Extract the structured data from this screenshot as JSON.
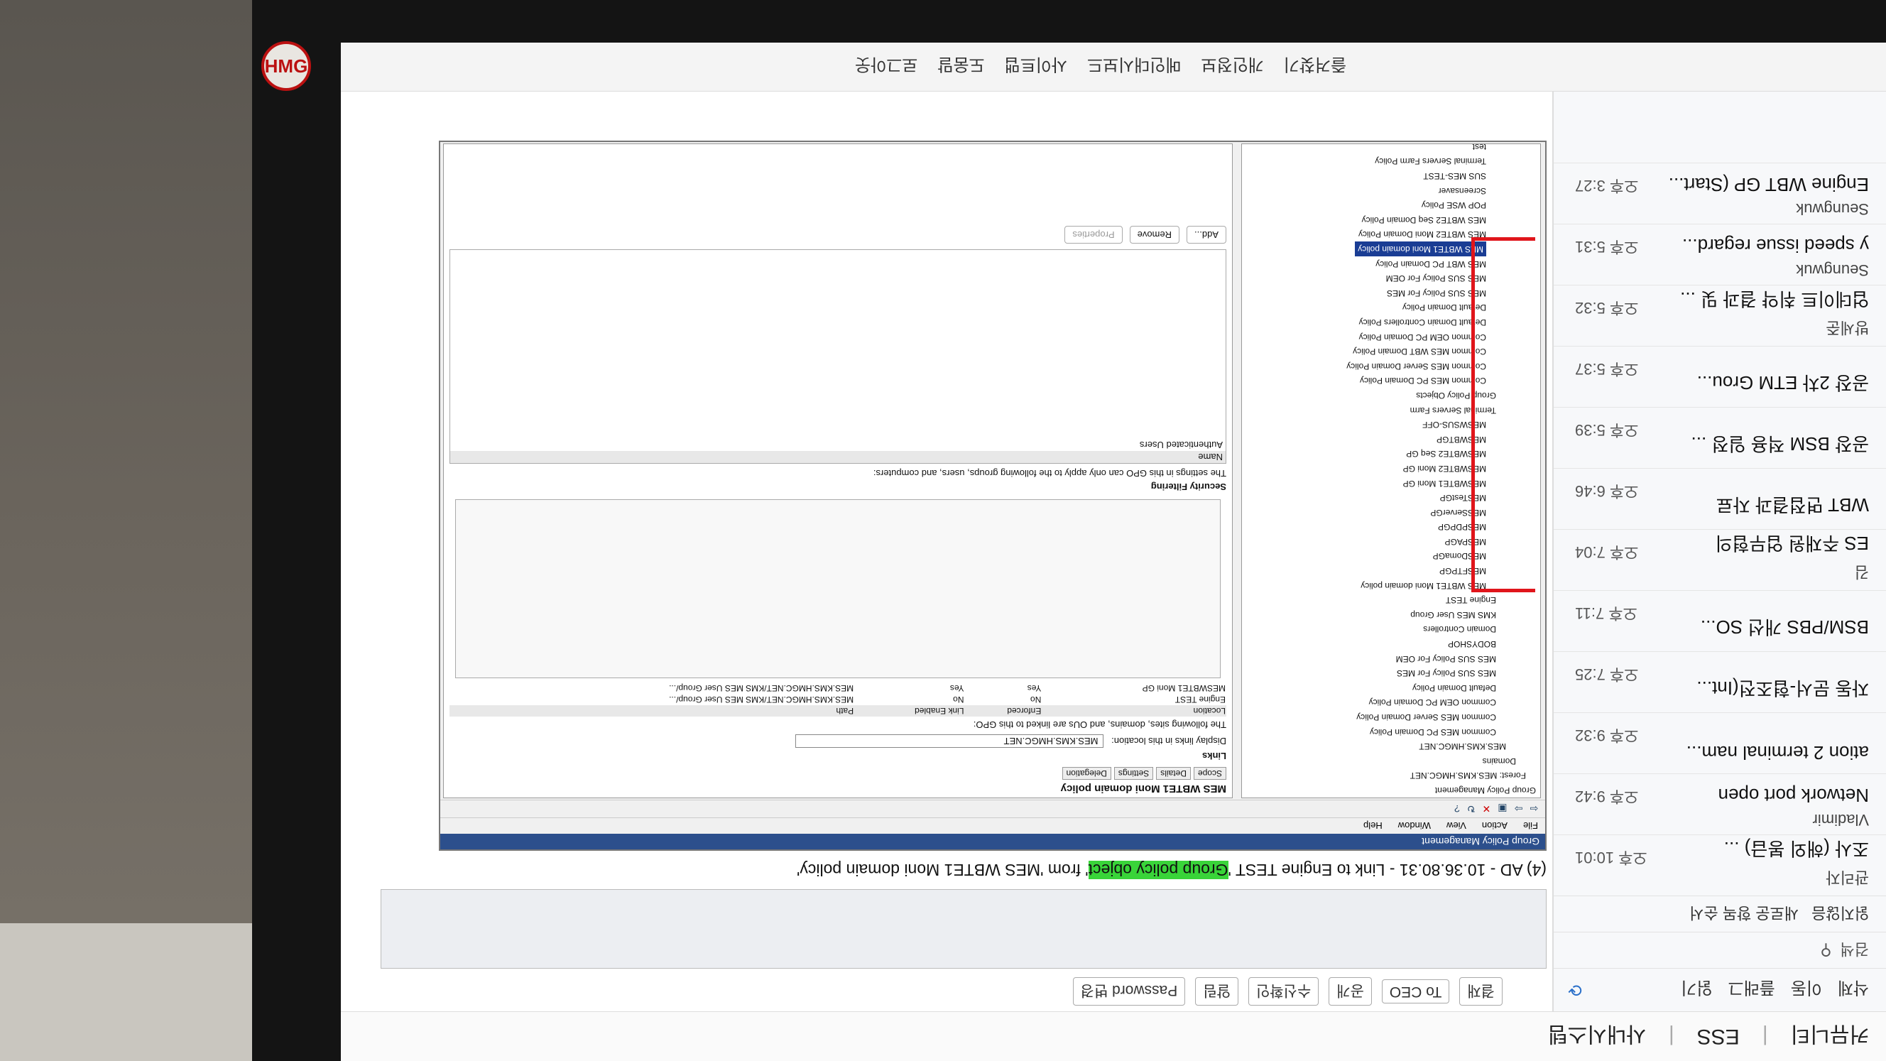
{
  "top_nav": [
    "커뮤니티",
    "ESS",
    "사내시스템"
  ],
  "bottom_nav": [
    "즐겨찾기",
    "개인정보",
    "메인대시보드",
    "사이트맵",
    "도움말",
    "로그아웃"
  ],
  "mail": {
    "toolbar": [
      "삭제",
      "이동",
      "플래그",
      "읽기"
    ],
    "search_placeholder": "검색",
    "filter": [
      "읽지않음",
      "새로운 항목 순서"
    ],
    "items": [
      {
        "sender": "관리자",
        "subject": "조사 (해외 봉급) ...",
        "time": "오후 10:01"
      },
      {
        "sender": "Vladimir",
        "subject": "Network port open",
        "time": "오후 9:42"
      },
      {
        "sender": "",
        "subject": "ation 2 terminal nam...",
        "time": "오후 9:32"
      },
      {
        "sender": "",
        "subject": "자동 문서-협조전(Int...",
        "time": "오후 7:25"
      },
      {
        "sender": "",
        "subject": "BSM/PBS 개선 SO...",
        "time": "오후 7:11"
      },
      {
        "sender": "김",
        "subject": "ES 주재원 업무협의",
        "time": "오후 7:04"
      },
      {
        "sender": "",
        "subject": "WBT 면접결과 자료",
        "time": "오후 6:46"
      },
      {
        "sender": "",
        "subject": "공장 BSM 적용 일정 ...",
        "time": "오후 5:39"
      },
      {
        "sender": "",
        "subject": "공장 2차 ETM Grou...",
        "time": "오후 5:37"
      },
      {
        "sender": "방세준",
        "subject": "업데이트 취약 결과 및 ...",
        "time": "오후 5:32"
      },
      {
        "sender": "Seungwuk",
        "subject": "y speed issue regard...",
        "time": "오후 5:31"
      },
      {
        "sender": "Seungwuk",
        "subject": "Engine WBT GP (Start...",
        "time": "오후 3:27"
      }
    ]
  },
  "content_toolbar": [
    "결재",
    "To CEO",
    "공개",
    "수신확인",
    "알림",
    "Password 변경"
  ],
  "caption_pre": "(4) AD - 10.36.80.31 - Link to Engine TEST '",
  "caption_hl": "Group policy object",
  "caption_post": "' from 'MES WBTE1 Moni domain policy'",
  "gpm": {
    "title": "Group Policy Management",
    "menu": [
      "File",
      "Action",
      "View",
      "Window",
      "Help"
    ],
    "pane_title": "MES WBTE1 Moni domain policy",
    "tabs": [
      "Scope",
      "Details",
      "Settings",
      "Delegation"
    ],
    "links_label": "Links",
    "display_links": "Display links in this location:",
    "location_value": "MES.KMS.HMGC.NET",
    "linked_text": "The following sites, domains, and OUs are linked to this GPO:",
    "link_cols": [
      "Location",
      "Enforced",
      "Link Enabled",
      "Path"
    ],
    "link_rows": [
      [
        "Engine TEST",
        "No",
        "No",
        "MES.KMS.HMGC.NET/KMS MES User Group/..."
      ],
      [
        "MESWBTE1 Moni GP",
        "Yes",
        "Yes",
        "MES.KMS.HMGC.NET/KMS MES User Group/..."
      ]
    ],
    "security_label": "Security Filtering",
    "security_text": "The settings in this GPO can only apply to the following groups, users, and computers:",
    "security_col": "Name",
    "security_row": "Authenticated Users",
    "buttons": [
      "Add...",
      "Remove",
      "Properties"
    ],
    "tree": [
      "Group Policy Management",
      "Forest: MES.KMS.HMGC.NET",
      "Domains",
      "MES.KMS.HMGC.NET",
      "Common MES PC Domain Policy",
      "Common MES Server Domain Policy",
      "Common OEM PC Domain Policy",
      "Default Domain Policy",
      "MES SUS Policy For MES",
      "MES SUS Policy For OEM",
      "BODYSHOP",
      "Domain Controllers",
      "KMS MES User Group",
      "Engine TEST",
      "MES WBTE1 Moni domain policy",
      "MESFTPGP",
      "MESDomaGP",
      "MESPAGP",
      "MESPDPGP",
      "MESServerGP",
      "MESTestGP",
      "MESWBTE1 Moni GP",
      "MESWBTE2 Moni GP",
      "MESWBTE2 Seq GP",
      "MESWBTGP",
      "MESWSUS-OFF",
      "Terminal Servers Farm",
      "Group Policy Objects",
      "Common MES PC Domain Policy",
      "Common MES Server Domain Policy",
      "Common MES WBT Domain Policy",
      "Common OEM PC Domain Policy",
      "Default Domain Controllers Policy",
      "Default Domain Policy",
      "MES SUS Policy For MES",
      "MES SUS Policy For OEM",
      "MES WBT PC Domain Policy",
      "MES WBTE1 Moni domain policy",
      "MES WBTE2 Moni Domain Policy",
      "MES WBTE2 Seq Domain Policy",
      "POP WSE Policy",
      "Screensaver",
      "SUS MES-TEST",
      "Terminal Servers Farm Policy",
      "test"
    ],
    "selected_index": 37
  },
  "logo": "HMG"
}
